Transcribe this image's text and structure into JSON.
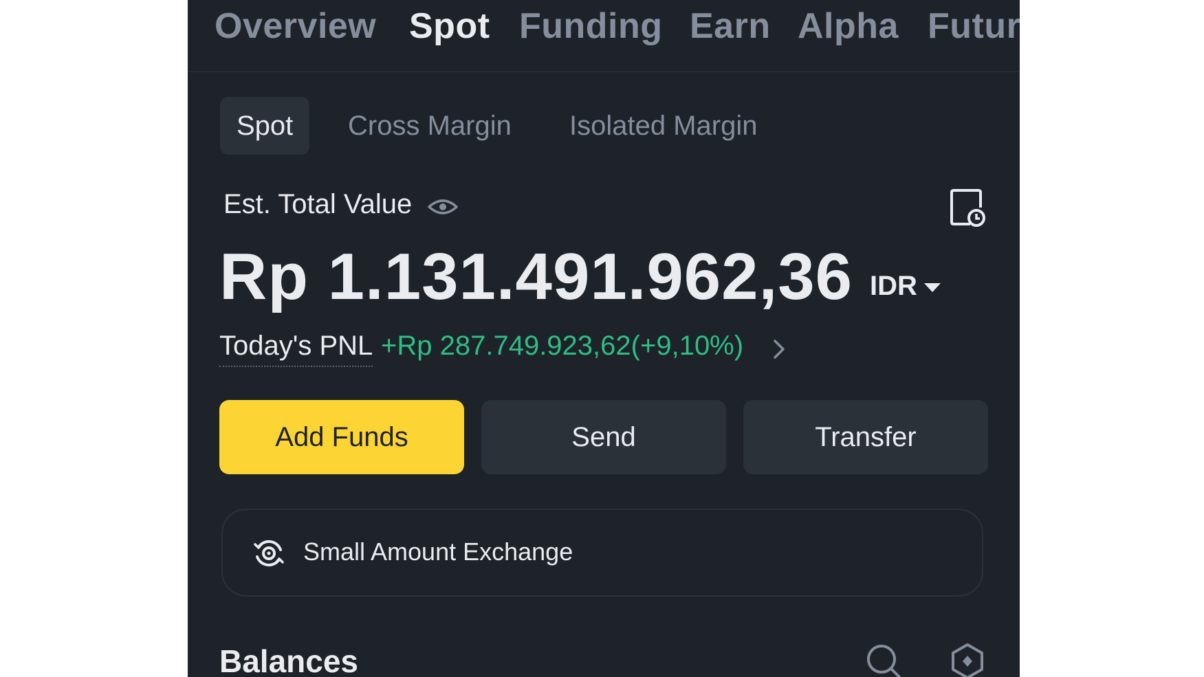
{
  "top_tabs": [
    {
      "label": "Overview",
      "active": false
    },
    {
      "label": "Spot",
      "active": true
    },
    {
      "label": "Funding",
      "active": false
    },
    {
      "label": "Earn",
      "active": false
    },
    {
      "label": "Alpha",
      "active": false
    },
    {
      "label": "Futures",
      "active": false
    }
  ],
  "sub_tabs": [
    {
      "label": "Spot",
      "active": true
    },
    {
      "label": "Cross Margin",
      "active": false
    },
    {
      "label": "Isolated Margin",
      "active": false
    }
  ],
  "summary": {
    "est_label": "Est. Total Value",
    "total_value": "Rp 1.131.491.962,36",
    "currency": "IDR",
    "pnl_label": "Today's PNL",
    "pnl_value": "+Rp 287.749.923,62(+9,10%)"
  },
  "actions": {
    "add_funds": "Add Funds",
    "send": "Send",
    "transfer": "Transfer"
  },
  "small_exchange": {
    "label": "Small Amount Exchange"
  },
  "balances": {
    "title": "Balances"
  },
  "icons": {
    "eye": "eye-icon",
    "history": "history-icon",
    "chevron": "chevron-right-icon",
    "exchange": "exchange-icon",
    "search": "search-icon",
    "settings": "settings-icon"
  },
  "colors": {
    "background": "#1e2329",
    "accent": "#fcd535",
    "positive": "#2ebd85",
    "text_primary": "#eaecef",
    "text_secondary": "#848e9c"
  }
}
